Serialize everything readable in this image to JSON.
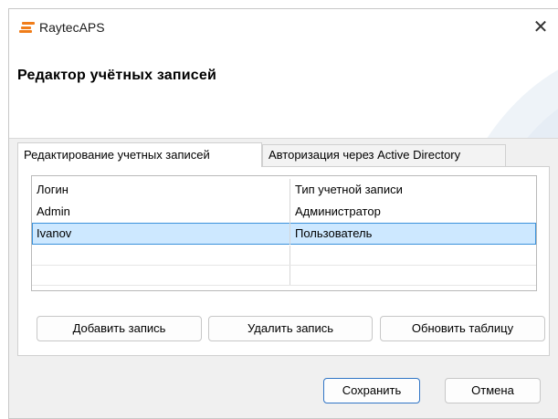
{
  "window": {
    "title": "RaytecAPS",
    "close_glyph": "✕"
  },
  "header": {
    "title": "Редактор учётных записей"
  },
  "tabs": [
    {
      "label": "Редактирование учетных записей",
      "active": true
    },
    {
      "label": "Авторизация через Active Directory",
      "active": false
    }
  ],
  "grid": {
    "columns": [
      "Логин",
      "Тип учетной записи"
    ],
    "rows": [
      {
        "login": "Admin",
        "type": "Администратор",
        "selected": false
      },
      {
        "login": "Ivanov",
        "type": "Пользователь",
        "selected": true
      }
    ]
  },
  "actions": {
    "add": "Добавить запись",
    "delete": "Удалить запись",
    "refresh": "Обновить таблицу"
  },
  "footer": {
    "save": "Сохранить",
    "cancel": "Отмена"
  },
  "colors": {
    "accent": "#f07d1a",
    "selection": "#cde8ff",
    "selection_border": "#3b92db",
    "primary_border": "#2f74c5"
  }
}
